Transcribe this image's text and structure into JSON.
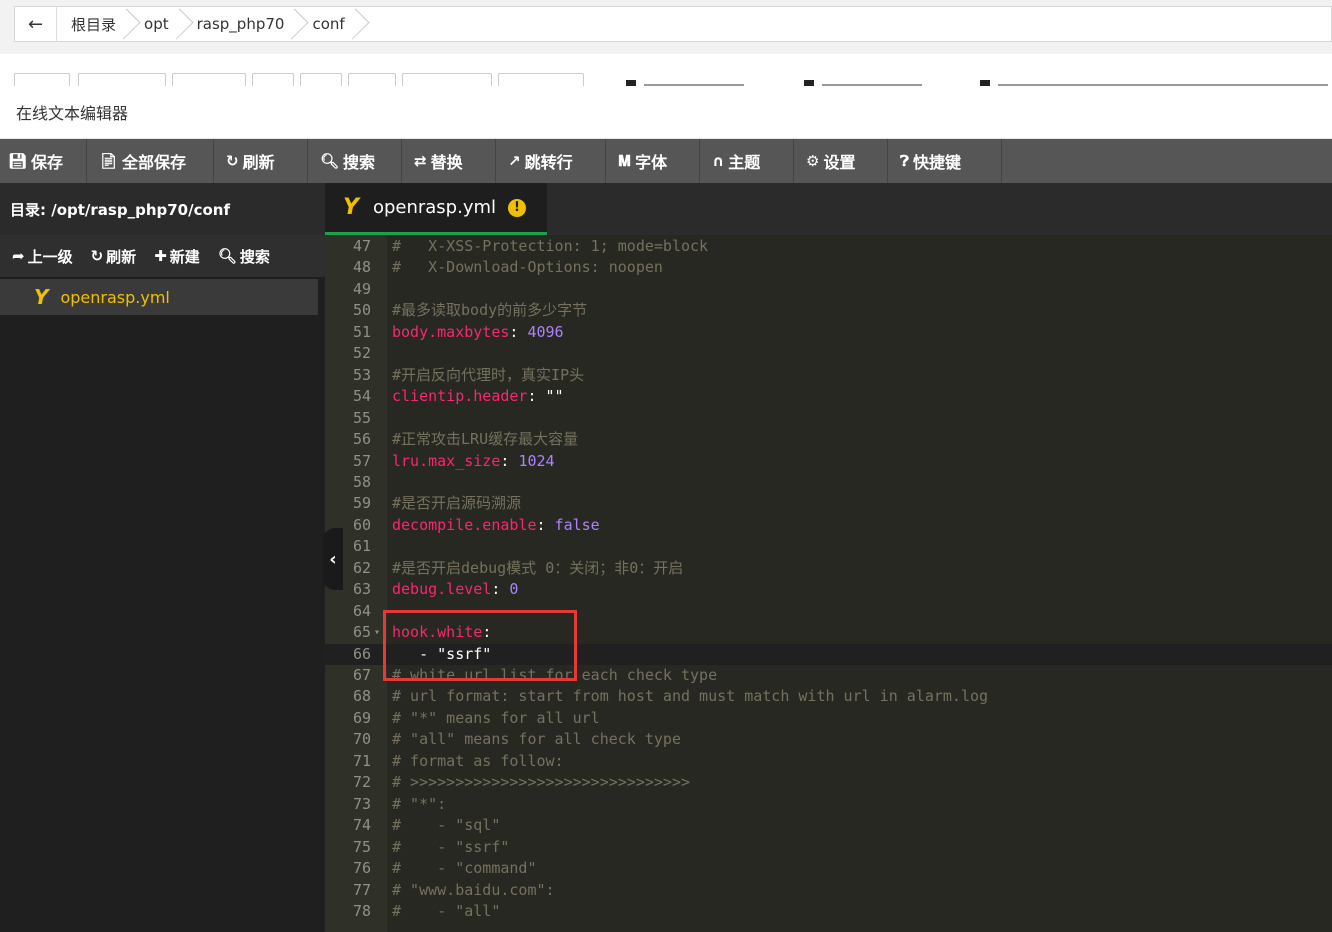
{
  "breadcrumb": {
    "items": [
      "根目录",
      "opt",
      "rasp_php70",
      "conf"
    ]
  },
  "window": {
    "title": "在线文本编辑器"
  },
  "toolbar": {
    "buttons": [
      {
        "icon": "save-icon",
        "label": "保存"
      },
      {
        "icon": "save-all-icon",
        "label": "全部保存"
      },
      {
        "icon": "refresh-icon",
        "label": "刷新"
      },
      {
        "icon": "search-icon",
        "label": "搜索"
      },
      {
        "icon": "replace-icon",
        "label": "替换"
      },
      {
        "icon": "goto-line-icon",
        "label": "跳转行"
      },
      {
        "icon": "font-icon",
        "label": "字体"
      },
      {
        "icon": "theme-icon",
        "label": "主题"
      },
      {
        "icon": "gear-icon",
        "label": "设置"
      },
      {
        "icon": "help-icon",
        "label": "快捷键"
      }
    ]
  },
  "sidebar": {
    "directory": "目录: /opt/rasp_php70/conf",
    "actions": [
      {
        "icon": "up-level-icon",
        "label": "上一级"
      },
      {
        "icon": "refresh-icon",
        "label": "刷新"
      },
      {
        "icon": "plus-icon",
        "label": "新建"
      },
      {
        "icon": "search-icon",
        "label": "搜索"
      }
    ],
    "files": [
      {
        "name": "openrasp.yml"
      }
    ]
  },
  "tabs": [
    {
      "label": "openrasp.yml",
      "status": "modified-warning"
    }
  ],
  "editor": {
    "active_line": 66,
    "lines": [
      {
        "n": "47",
        "parts": [
          {
            "c": "comment",
            "t": "#   X-XSS-Protection: 1; mode=block"
          }
        ]
      },
      {
        "n": "48",
        "parts": [
          {
            "c": "comment",
            "t": "#   X-Download-Options: noopen"
          }
        ]
      },
      {
        "n": "49",
        "parts": []
      },
      {
        "n": "50",
        "parts": [
          {
            "c": "comment",
            "t": "#最多读取body的前多少字节"
          }
        ]
      },
      {
        "n": "51",
        "parts": [
          {
            "c": "key",
            "t": "body.maxbytes"
          },
          {
            "c": "plain",
            "t": ": "
          },
          {
            "c": "num",
            "t": "4096"
          }
        ]
      },
      {
        "n": "52",
        "parts": []
      },
      {
        "n": "53",
        "parts": [
          {
            "c": "comment",
            "t": "#开启反向代理时，真实IP头"
          }
        ]
      },
      {
        "n": "54",
        "parts": [
          {
            "c": "key",
            "t": "clientip.header"
          },
          {
            "c": "plain",
            "t": ": "
          },
          {
            "c": "white",
            "t": "\"\""
          }
        ]
      },
      {
        "n": "55",
        "parts": []
      },
      {
        "n": "56",
        "parts": [
          {
            "c": "comment",
            "t": "#正常攻击LRU缓存最大容量"
          }
        ]
      },
      {
        "n": "57",
        "parts": [
          {
            "c": "key",
            "t": "lru.max_size"
          },
          {
            "c": "plain",
            "t": ": "
          },
          {
            "c": "num",
            "t": "1024"
          }
        ]
      },
      {
        "n": "58",
        "parts": []
      },
      {
        "n": "59",
        "parts": [
          {
            "c": "comment",
            "t": "#是否开启源码溯源"
          }
        ]
      },
      {
        "n": "60",
        "parts": [
          {
            "c": "key",
            "t": "decompile.enable"
          },
          {
            "c": "plain",
            "t": ": "
          },
          {
            "c": "bool",
            "t": "false"
          }
        ]
      },
      {
        "n": "61",
        "parts": []
      },
      {
        "n": "62",
        "parts": [
          {
            "c": "comment",
            "t": "#是否开启debug模式 0：关闭；非0：开启"
          }
        ]
      },
      {
        "n": "63",
        "parts": [
          {
            "c": "key",
            "t": "debug.level"
          },
          {
            "c": "plain",
            "t": ": "
          },
          {
            "c": "num",
            "t": "0"
          }
        ]
      },
      {
        "n": "64",
        "parts": []
      },
      {
        "n": "65",
        "fold": true,
        "parts": [
          {
            "c": "key",
            "t": "hook.white"
          },
          {
            "c": "plain",
            "t": ":"
          }
        ]
      },
      {
        "n": "66",
        "parts": [
          {
            "c": "plain",
            "t": "   - "
          },
          {
            "c": "white",
            "t": "\"ssrf\""
          }
        ]
      },
      {
        "n": "67",
        "parts": [
          {
            "c": "comment",
            "t": "# white url list for each check type"
          }
        ]
      },
      {
        "n": "68",
        "parts": [
          {
            "c": "comment",
            "t": "# url format: start from host and must match with url in alarm.log"
          }
        ]
      },
      {
        "n": "69",
        "parts": [
          {
            "c": "comment",
            "t": "# \"*\" means for all url"
          }
        ]
      },
      {
        "n": "70",
        "parts": [
          {
            "c": "comment",
            "t": "# \"all\" means for all check type"
          }
        ]
      },
      {
        "n": "71",
        "parts": [
          {
            "c": "comment",
            "t": "# format as follow:"
          }
        ]
      },
      {
        "n": "72",
        "parts": [
          {
            "c": "comment",
            "t": "# >>>>>>>>>>>>>>>>>>>>>>>>>>>>>>>"
          }
        ]
      },
      {
        "n": "73",
        "parts": [
          {
            "c": "comment",
            "t": "# \"*\":"
          }
        ]
      },
      {
        "n": "74",
        "parts": [
          {
            "c": "comment",
            "t": "#    - \"sql\""
          }
        ]
      },
      {
        "n": "75",
        "parts": [
          {
            "c": "comment",
            "t": "#    - \"ssrf\""
          }
        ]
      },
      {
        "n": "76",
        "parts": [
          {
            "c": "comment",
            "t": "#    - \"command\""
          }
        ]
      },
      {
        "n": "77",
        "parts": [
          {
            "c": "comment",
            "t": "# \"www.baidu.com\":"
          }
        ]
      },
      {
        "n": "78",
        "parts": [
          {
            "c": "comment",
            "t": "#    - \"all\""
          }
        ]
      }
    ]
  },
  "annotation": {
    "color": "#e53935"
  }
}
